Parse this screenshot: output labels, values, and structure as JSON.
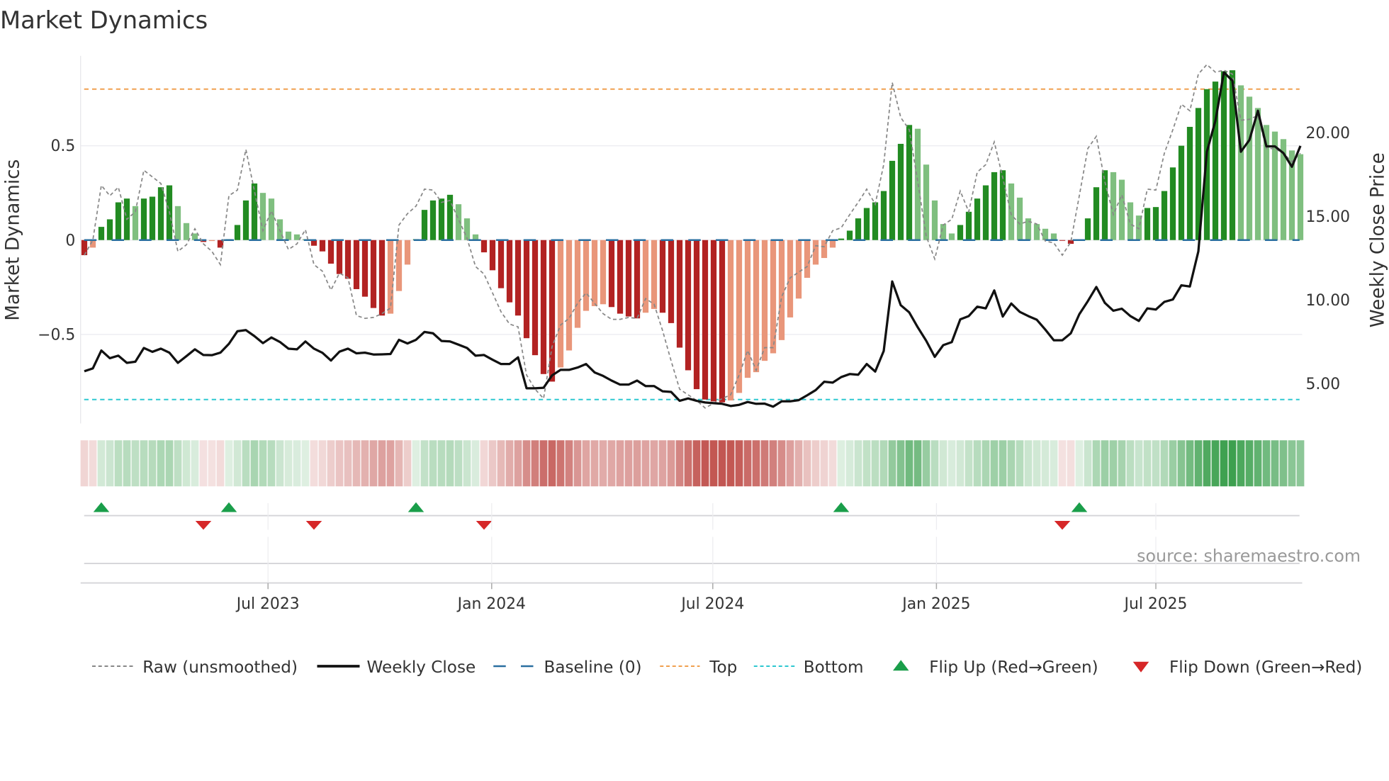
{
  "title": "Market Dynamics",
  "source": "source: sharemaestro.com",
  "colors": {
    "up_strong": "#228b22",
    "up_weak": "#7fbf7f",
    "down_strong": "#b22222",
    "down_weak": "#e9967a",
    "raw": "#888888",
    "close": "#111111",
    "baseline": "#2a6fa0",
    "top": "#f0a050",
    "bottom": "#2ec8d0",
    "flip_up": "#1a9e4a",
    "flip_down": "#d62728"
  },
  "chart_data": {
    "type": "bar",
    "title": "Market Dynamics",
    "ylabel": "Market Dynamics",
    "y2label": "Weekly Close Price",
    "ylim": [
      -0.96,
      0.99
    ],
    "y2lim": [
      2.77,
      24.77
    ],
    "frequency": "weekly",
    "y_ticks": [
      {
        "label": "0.5",
        "value": 0.5
      },
      {
        "label": "0",
        "value": 0
      },
      {
        "label": "−0.5",
        "value": -0.5
      }
    ],
    "y2_ticks": [
      {
        "label": "20.00",
        "value": 20
      },
      {
        "label": "15.00",
        "value": 15
      },
      {
        "label": "10.00",
        "value": 10
      },
      {
        "label": "5.00",
        "value": 5
      }
    ],
    "x_ticks": [
      {
        "label": "Jul 2023",
        "week": 21.6
      },
      {
        "label": "Jan 2024",
        "week": 47.9
      },
      {
        "label": "Jul 2024",
        "week": 73.9
      },
      {
        "label": "Jan 2025",
        "week": 100.2
      },
      {
        "label": "Jul 2025",
        "week": 126.0
      }
    ],
    "top_level": 0.8,
    "bottom_level": -0.845,
    "baseline": 0,
    "momentum": [
      -0.08,
      -0.04,
      0.07,
      0.11,
      0.2,
      0.22,
      0.18,
      0.22,
      0.23,
      0.28,
      0.29,
      0.18,
      0.09,
      0.035,
      -0.01,
      -0.005,
      -0.04,
      0.005,
      0.08,
      0.21,
      0.3,
      0.25,
      0.22,
      0.11,
      0.045,
      0.03,
      0.005,
      -0.03,
      -0.06,
      -0.125,
      -0.18,
      -0.205,
      -0.26,
      -0.3,
      -0.36,
      -0.4,
      -0.39,
      -0.27,
      -0.13,
      0.005,
      0.16,
      0.21,
      0.22,
      0.24,
      0.19,
      0.115,
      0.03,
      -0.065,
      -0.16,
      -0.255,
      -0.33,
      -0.4,
      -0.52,
      -0.61,
      -0.71,
      -0.75,
      -0.675,
      -0.585,
      -0.465,
      -0.375,
      -0.35,
      -0.34,
      -0.355,
      -0.39,
      -0.405,
      -0.415,
      -0.385,
      -0.365,
      -0.385,
      -0.44,
      -0.57,
      -0.69,
      -0.79,
      -0.845,
      -0.855,
      -0.86,
      -0.85,
      -0.81,
      -0.73,
      -0.7,
      -0.64,
      -0.6,
      -0.53,
      -0.41,
      -0.31,
      -0.2,
      -0.13,
      -0.095,
      -0.04,
      0.008,
      0.05,
      0.115,
      0.17,
      0.2,
      0.26,
      0.42,
      0.51,
      0.61,
      0.59,
      0.4,
      0.21,
      0.085,
      0.035,
      0.08,
      0.15,
      0.22,
      0.29,
      0.36,
      0.37,
      0.3,
      0.225,
      0.115,
      0.085,
      0.06,
      0.035,
      -0.003,
      -0.02,
      0.003,
      0.115,
      0.28,
      0.37,
      0.36,
      0.32,
      0.2,
      0.13,
      0.17,
      0.175,
      0.26,
      0.385,
      0.5,
      0.6,
      0.7,
      0.8,
      0.84,
      0.895,
      0.9,
      0.82,
      0.76,
      0.7,
      0.61,
      0.575,
      0.535,
      0.475,
      0.455
    ],
    "raw": [
      -0.08,
      0,
      0.29,
      0.235,
      0.28,
      0.11,
      0.15,
      0.37,
      0.335,
      0.3,
      0.15,
      -0.06,
      -0.025,
      0.06,
      -0.02,
      -0.06,
      -0.13,
      0.235,
      0.265,
      0.48,
      0.26,
      0.05,
      0.155,
      0.05,
      -0.05,
      -0.02,
      0.055,
      -0.13,
      -0.165,
      -0.265,
      -0.175,
      -0.2,
      -0.4,
      -0.415,
      -0.41,
      -0.39,
      -0.36,
      0.08,
      0.14,
      0.18,
      0.27,
      0.265,
      0.2,
      0.21,
      0.11,
      0.01,
      -0.14,
      -0.18,
      -0.28,
      -0.38,
      -0.445,
      -0.46,
      -0.715,
      -0.79,
      -0.84,
      -0.565,
      -0.45,
      -0.415,
      -0.335,
      -0.28,
      -0.335,
      -0.39,
      -0.42,
      -0.42,
      -0.41,
      -0.415,
      -0.31,
      -0.34,
      -0.48,
      -0.64,
      -0.79,
      -0.82,
      -0.85,
      -0.89,
      -0.865,
      -0.84,
      -0.82,
      -0.715,
      -0.585,
      -0.69,
      -0.57,
      -0.57,
      -0.3,
      -0.2,
      -0.17,
      -0.14,
      -0.03,
      -0.035,
      0.05,
      0.065,
      0.135,
      0.2,
      0.27,
      0.19,
      0.4,
      0.835,
      0.65,
      0.585,
      0.31,
      0.02,
      -0.1,
      0.08,
      0.11,
      0.26,
      0.15,
      0.36,
      0.4,
      0.52,
      0.33,
      0.135,
      0.085,
      0.1,
      0.085,
      -0.005,
      -0.015,
      -0.08,
      -0.01,
      0.235,
      0.485,
      0.55,
      0.31,
      0.135,
      0.24,
      0.085,
      0.06,
      0.27,
      0.265,
      0.46,
      0.585,
      0.72,
      0.685,
      0.88,
      0.93,
      0.89,
      0.9,
      0.88,
      0.635,
      0.64,
      0.66,
      0.485,
      0.485,
      0.46,
      0.415,
      0.46
    ],
    "close": [
      5.74,
      5.91,
      6.98,
      6.52,
      6.67,
      6.24,
      6.31,
      7.13,
      6.9,
      7.09,
      6.85,
      6.24,
      6.64,
      7.05,
      6.71,
      6.7,
      6.85,
      7.38,
      8.13,
      8.2,
      7.84,
      7.42,
      7.76,
      7.49,
      7.09,
      7.05,
      7.52,
      7.09,
      6.84,
      6.38,
      6.91,
      7.09,
      6.81,
      6.85,
      6.74,
      6.75,
      6.77,
      7.62,
      7.4,
      7.62,
      8.09,
      8.01,
      7.55,
      7.52,
      7.33,
      7.13,
      6.67,
      6.71,
      6.43,
      6.17,
      6.17,
      6.57,
      4.72,
      4.72,
      4.75,
      5.49,
      5.82,
      5.82,
      5.96,
      6.17,
      5.67,
      5.46,
      5.18,
      4.94,
      4.94,
      5.18,
      4.85,
      4.85,
      4.54,
      4.5,
      3.97,
      4.11,
      3.97,
      3.87,
      3.83,
      3.79,
      3.66,
      3.73,
      3.9,
      3.79,
      3.8,
      3.62,
      3.94,
      3.94,
      4.01,
      4.3,
      4.61,
      5.11,
      5.06,
      5.39,
      5.57,
      5.53,
      6.17,
      5.72,
      6.95,
      11.11,
      9.69,
      9.26,
      8.37,
      7.56,
      6.6,
      7.3,
      7.48,
      8.84,
      9.04,
      9.6,
      9.5,
      10.57,
      9.01,
      9.79,
      9.29,
      9.04,
      8.82,
      8.23,
      7.59,
      7.59,
      8.01,
      9.15,
      9.93,
      10.78,
      9.83,
      9.36,
      9.48,
      9.04,
      8.75,
      9.5,
      9.43,
      9.89,
      10.03,
      10.88,
      10.81,
      12.91,
      18.87,
      20.71,
      23.62,
      23.12,
      18.87,
      19.57,
      21.32,
      19.19,
      19.19,
      18.79,
      17.97,
      19.22
    ],
    "legend": {
      "placement": "bottom",
      "items": [
        {
          "label": "Raw (unsmoothed)",
          "style": "raw"
        },
        {
          "label": "Weekly Close",
          "style": "close"
        },
        {
          "label": "Baseline (0)",
          "style": "baseline"
        },
        {
          "label": "Top",
          "style": "top"
        },
        {
          "label": "Bottom",
          "style": "bottom"
        },
        {
          "label": "Flip Up (Red→Green)",
          "style": "flip_up"
        },
        {
          "label": "Flip Down (Green→Red)",
          "style": "flip_down"
        }
      ]
    }
  }
}
